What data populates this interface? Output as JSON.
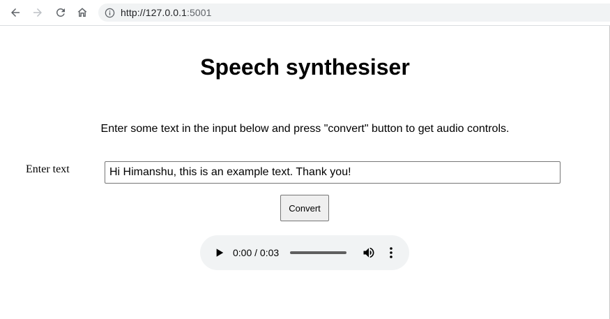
{
  "browser": {
    "url_scheme_host": "http://127.0.0.1",
    "url_port": ":5001",
    "icons": {
      "back": "arrow-left-icon",
      "forward": "arrow-right-icon",
      "reload": "reload-icon",
      "home": "home-icon",
      "info": "info-icon"
    }
  },
  "page": {
    "title": "Speech synthesiser",
    "instructions": "Enter some text in the input below and press \"convert\" button to get audio controls.",
    "input_label": "Enter text",
    "input_value": "Hi Himanshu, this is an example text. Thank you!",
    "convert_label": "Convert"
  },
  "audio": {
    "time_display": "0:00 / 0:03",
    "progress": 0,
    "icons": {
      "play": "play-icon",
      "volume": "volume-icon",
      "more": "more-vert-icon"
    }
  }
}
